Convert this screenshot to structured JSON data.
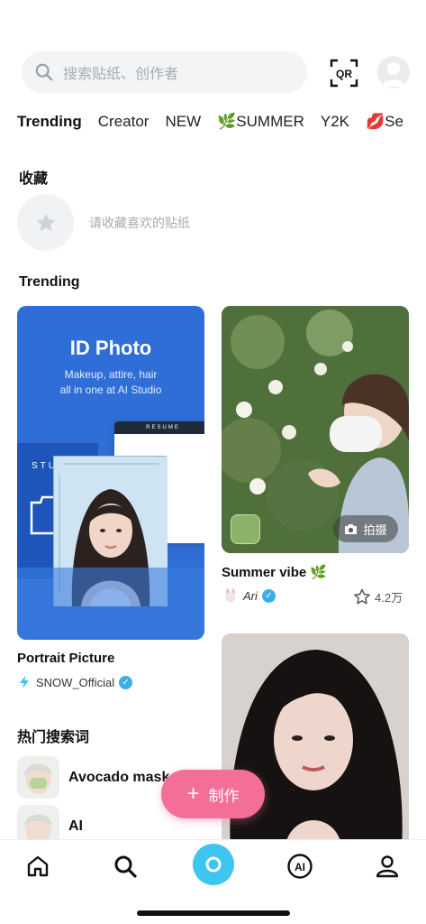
{
  "search": {
    "placeholder": "搜索贴纸、创作者",
    "qr_label": "QR"
  },
  "tabs": [
    {
      "label": "Trending"
    },
    {
      "label": "Creator"
    },
    {
      "label": "NEW"
    },
    {
      "label": "🌿SUMMER"
    },
    {
      "label": "Y2K"
    },
    {
      "label": "💋Se"
    }
  ],
  "favorites": {
    "title": "收藏",
    "hint": "请收藏喜欢的贴纸"
  },
  "trending": {
    "title": "Trending",
    "cards": [
      {
        "headline": "ID Photo",
        "subline1": "Makeup, attire, hair",
        "subline2": "all in one at AI Studio",
        "resume_label": "RESUME",
        "studio_label": "STU",
        "title": "Portrait Picture",
        "author": "SNOW_Official"
      },
      {
        "shoot_label": "拍摄",
        "title": "Summer vibe 🌿",
        "author": "Ari",
        "likes": "4.2万"
      },
      {
        "title": ""
      }
    ]
  },
  "hot_search": {
    "title": "热门搜索词",
    "items": [
      {
        "label": "Avocado mask"
      },
      {
        "label": "AI"
      }
    ]
  },
  "make_button": {
    "label": "制作"
  },
  "colors": {
    "accent_pink": "#f36f98",
    "camera_blue": "#3ec6f0",
    "verified_blue": "#3aaee8"
  }
}
